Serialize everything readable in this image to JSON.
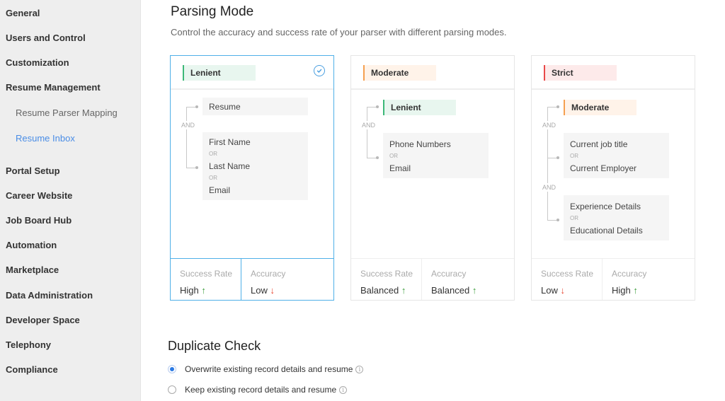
{
  "sidebar": {
    "items": [
      {
        "label": "General"
      },
      {
        "label": "Users and Control"
      },
      {
        "label": "Customization"
      },
      {
        "label": "Resume Management"
      },
      {
        "label": "Resume Parser Mapping",
        "sub": true
      },
      {
        "label": "Resume Inbox",
        "sub": true,
        "active": true
      },
      {
        "label": "Portal Setup"
      },
      {
        "label": "Career Website"
      },
      {
        "label": "Job Board Hub"
      },
      {
        "label": "Automation"
      },
      {
        "label": "Marketplace"
      },
      {
        "label": "Data Administration"
      },
      {
        "label": "Developer Space"
      },
      {
        "label": "Telephony"
      },
      {
        "label": "Compliance"
      }
    ]
  },
  "parsing": {
    "title": "Parsing Mode",
    "subtitle": "Control the accuracy and success rate of your parser with different parsing modes.",
    "and_label": "AND",
    "or_label": "OR",
    "success_rate_label": "Success Rate",
    "accuracy_label": "Accuracy",
    "modes": [
      {
        "name": "Lenient",
        "selected": true,
        "fields": [
          "Resume",
          "First Name",
          "Last Name",
          "Email"
        ],
        "success_rate": "High",
        "success_trend": "up",
        "accuracy": "Low",
        "accuracy_trend": "down"
      },
      {
        "name": "Moderate",
        "selected": false,
        "includes": "Lenient",
        "fields": [
          "Phone Numbers",
          "Email"
        ],
        "success_rate": "Balanced",
        "success_trend": "up",
        "accuracy": "Balanced",
        "accuracy_trend": "up"
      },
      {
        "name": "Strict",
        "selected": false,
        "includes": "Moderate",
        "fields": [
          "Current job title",
          "Current Employer",
          "Experience Details",
          "Educational Details"
        ],
        "success_rate": "Low",
        "success_trend": "down",
        "accuracy": "High",
        "accuracy_trend": "up"
      }
    ],
    "arrows": {
      "up": "↑",
      "down": "↓"
    }
  },
  "duplicate_check": {
    "title": "Duplicate Check",
    "options": [
      {
        "label": "Overwrite existing record details and resume",
        "checked": true
      },
      {
        "label": "Keep existing record details and resume",
        "checked": false
      }
    ],
    "info_icon": "i"
  },
  "colors": {
    "accent": "#4a8de6",
    "selected_border": "#4fb0e8",
    "lenient": "#3cb878",
    "moderate": "#f5a050",
    "strict": "#e84848",
    "trend_up": "#3a9d3a",
    "trend_down": "#e8442e"
  }
}
